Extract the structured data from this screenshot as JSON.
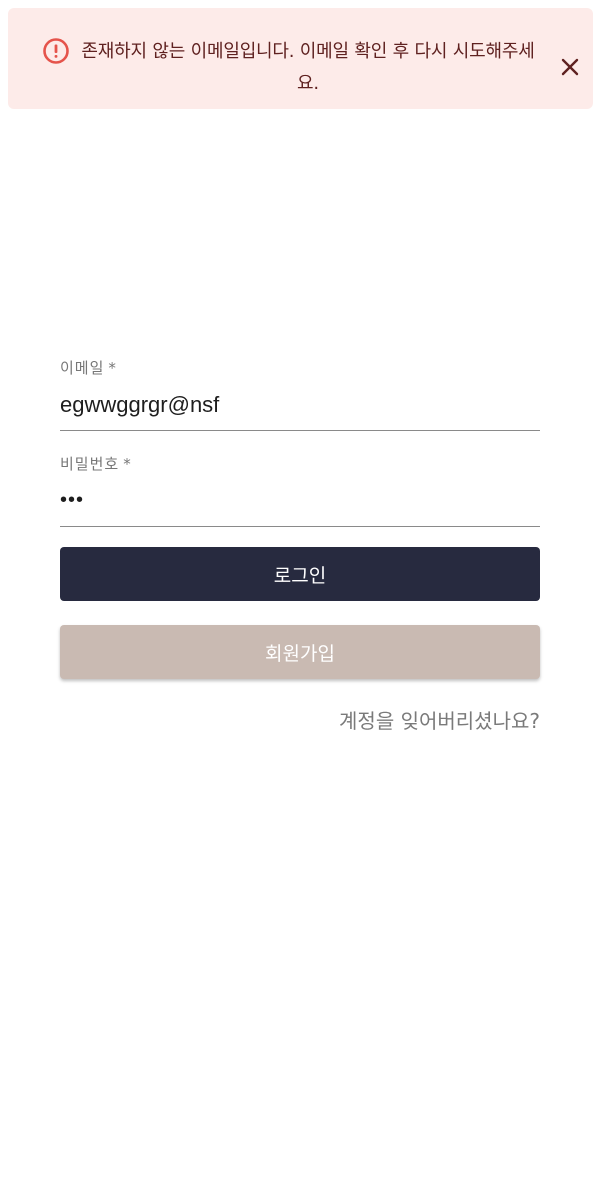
{
  "alert": {
    "message": "존재하지 않는 이메일입니다. 이메일 확인 후 다시 시도해주세요.",
    "icon": "error-circle-icon",
    "close_icon": "close-icon",
    "colors": {
      "background": "#fdebe9",
      "icon": "#e5534b",
      "text": "#5f2120"
    }
  },
  "form": {
    "email": {
      "label": "이메일",
      "required_mark": "*",
      "value": "egwwggrgr@nsf"
    },
    "password": {
      "label": "비밀번호",
      "required_mark": "*",
      "value": "•••"
    },
    "login_button": "로그인",
    "signup_button": "회원가입",
    "forgot_link": "계정을 잊어버리셨나요?"
  },
  "colors": {
    "login_button": "#272a3f",
    "signup_button": "#c9bab2"
  }
}
